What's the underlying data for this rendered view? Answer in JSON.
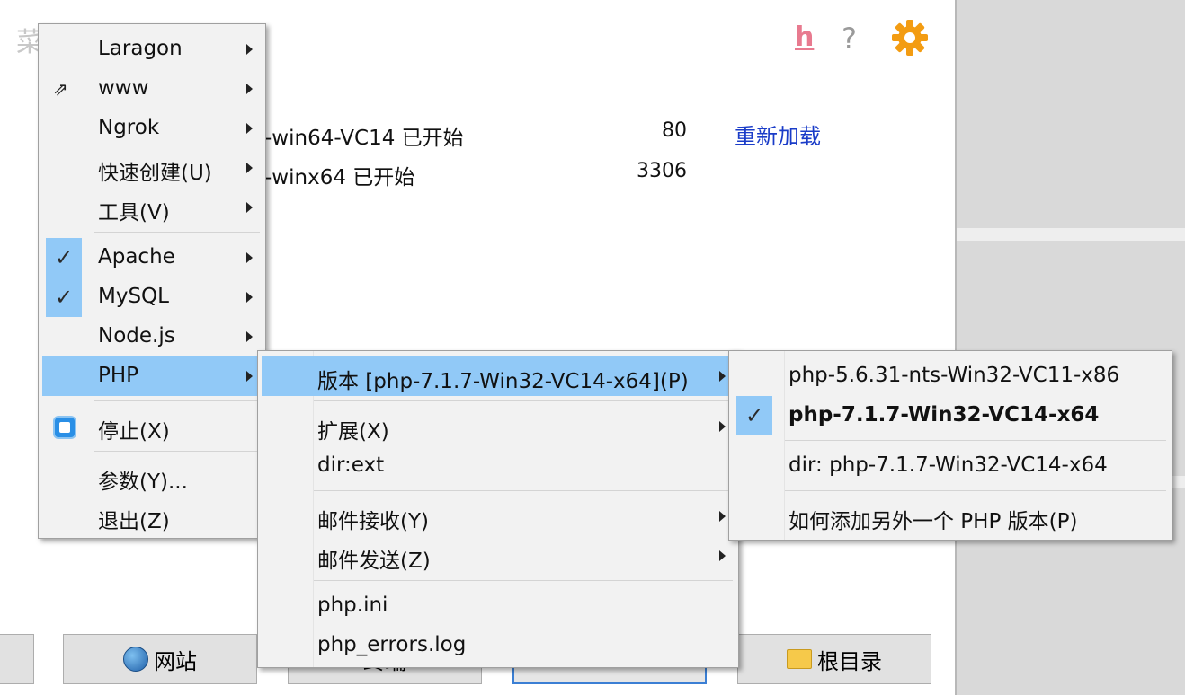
{
  "window": {
    "title": "菜单",
    "header_icons": {
      "help_h": "h",
      "help_q": "?",
      "settings_icon": "gear-icon",
      "accent": "#f39c12"
    }
  },
  "services": [
    {
      "name": "-win64-VC14 已开始",
      "port": "80"
    },
    {
      "name": "-winx64 已开始",
      "port": "3306"
    }
  ],
  "reload_label": "重新加载",
  "bottom_buttons": {
    "web": "网站",
    "terminal": "终端",
    "root": "根目录"
  },
  "main_menu": {
    "items": [
      {
        "label": "Laragon"
      },
      {
        "label": "www"
      },
      {
        "label": "Ngrok"
      },
      {
        "label": "快速创建(U)"
      },
      {
        "label": "工具(V)"
      },
      {
        "label": "Apache"
      },
      {
        "label": "MySQL"
      },
      {
        "label": "Node.js"
      },
      {
        "label": "PHP"
      },
      {
        "label": "停止(X)"
      },
      {
        "label": "参数(Y)..."
      },
      {
        "label": "退出(Z)"
      }
    ]
  },
  "php_menu": {
    "items": [
      {
        "label": "版本 [php-7.1.7-Win32-VC14-x64](P)"
      },
      {
        "label": "扩展(X)"
      },
      {
        "label": "dir:ext"
      },
      {
        "label": "邮件接收(Y)"
      },
      {
        "label": "邮件发送(Z)"
      },
      {
        "label": "php.ini"
      },
      {
        "label": "php_errors.log"
      }
    ]
  },
  "version_menu": {
    "items": [
      {
        "label": "php-5.6.31-nts-Win32-VC11-x86"
      },
      {
        "label": "php-7.1.7-Win32-VC14-x64"
      },
      {
        "label": "dir: php-7.1.7-Win32-VC14-x64"
      },
      {
        "label": "如何添加另外一个 PHP 版本(P)"
      }
    ]
  },
  "colors": {
    "highlight": "#91c9f7",
    "menu_bg": "#f2f2f2",
    "link": "#1a3cc8"
  }
}
